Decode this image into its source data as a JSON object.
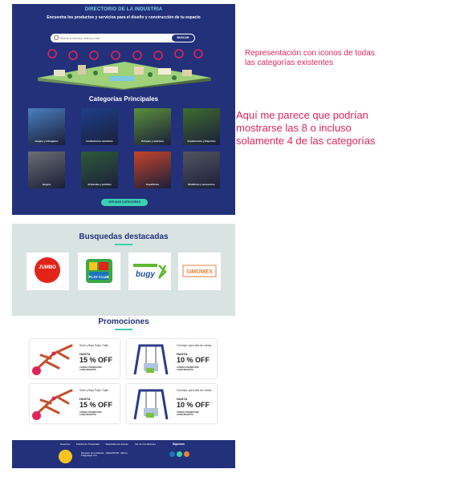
{
  "hero": {
    "title": "DIRECTORIO DE LA INDUSTRIA",
    "subtitle": "Encuentra los productos y servicios para el diseño y construcción de tu espacio",
    "search_placeholder": "Buscar productos, marca y más",
    "search_button": "BUSCAR",
    "categories_heading": "Categorías Principales",
    "categories": [
      {
        "label": "Juegos y toboganes",
        "color": "#4a7fbf"
      },
      {
        "label": "Instalaciones acuáticas",
        "color": "#1e3f8a"
      },
      {
        "label": "Parques y aventura",
        "color": "#5b8f3a"
      },
      {
        "label": "Implementos y Deportes",
        "color": "#3f6b2e"
      },
      {
        "label": "Juegos",
        "color": "#6c6e73"
      },
      {
        "label": "Arboledas y jardines",
        "color": "#2f5a3a"
      },
      {
        "label": "Superficies",
        "color": "#c6442a"
      },
      {
        "label": "Mobiliario y accesorios",
        "color": "#52555e"
      }
    ],
    "see_more": "VER MÁS CATEGORÍAS"
  },
  "annotations": {
    "note1": "Representación con iconos de todas las categorías existentes",
    "note2": "Aquí me parece que podrían mostrarse las 8 o incluso solamente 4 de las categorías"
  },
  "featured": {
    "title": "Busquedas destacadas",
    "brands": [
      "JUMBO",
      "PLAY CLUB",
      "bugy",
      "SIMUMEX"
    ]
  },
  "promos": {
    "title": "Promociones",
    "cards": [
      {
        "name": "Sube y Baja Pulpo Triple",
        "hasta": "HASTA",
        "off": "15 % OFF",
        "code": "CÓDIGO PROMOCIÓN CONCURSOPTIS"
      },
      {
        "name": "Columpio para silla de ruedas",
        "hasta": "HASTA",
        "off": "10 % OFF",
        "code": "CÓDIGO PROMOCIÓN CONCURSOPTIS"
      },
      {
        "name": "Sube y Baja Pulpo Triple",
        "hasta": "HASTA",
        "off": "15 % OFF",
        "code": "CÓDIGO PROMOCIÓN CONCURSOPTIS"
      },
      {
        "name": "Columpio para silla de ruedas",
        "hasta": "HASTA",
        "off": "10 % OFF",
        "code": "CÓDIGO PROMOCIÓN CONCURSOPTIS"
      }
    ]
  },
  "footer": {
    "links": [
      "Nosotros",
      "Política de Privacidad",
      "Requisitos de acceso",
      "Ver de Condiciones"
    ],
    "follow": "Síguenos",
    "address": "Directorio de la Industria · JUEGOSCOM · México · info@juegos.com"
  },
  "colors": {
    "navy": "#22317a",
    "teal": "#3bd1b0",
    "annotation": "#e0245a",
    "section_bg": "#d9e3e2"
  }
}
